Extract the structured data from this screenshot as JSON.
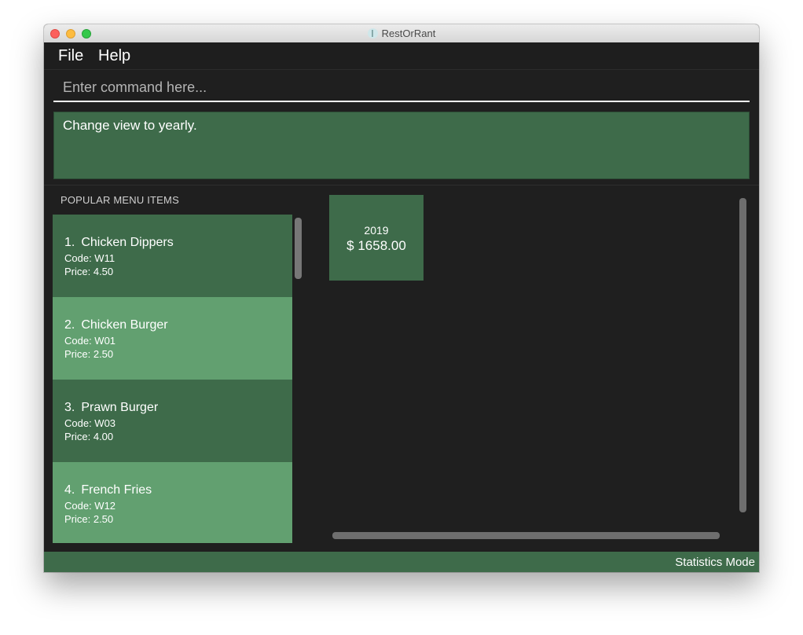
{
  "window": {
    "title": "RestOrRant"
  },
  "menu": {
    "file": "File",
    "help": "Help"
  },
  "command": {
    "placeholder": "Enter command here...",
    "value": ""
  },
  "result": {
    "message": "Change view to yearly."
  },
  "menu_list": {
    "header": "POPULAR MENU ITEMS",
    "items": [
      {
        "index": "1.",
        "name": "Chicken Dippers",
        "code": "Code: W11",
        "price": "Price: 4.50"
      },
      {
        "index": "2.",
        "name": "Chicken Burger",
        "code": "Code: W01",
        "price": "Price: 2.50"
      },
      {
        "index": "3.",
        "name": "Prawn Burger",
        "code": "Code: W03",
        "price": "Price: 4.00"
      },
      {
        "index": "4.",
        "name": "French Fries",
        "code": "Code: W12",
        "price": "Price: 2.50"
      }
    ]
  },
  "statistics": {
    "tiles": [
      {
        "year": "2019",
        "amount": "$ 1658.00"
      }
    ]
  },
  "status": {
    "mode": "Statistics Mode"
  },
  "colors": {
    "background": "#1f1f1f",
    "card_dark": "#3e6b4a",
    "card_light": "#62a070",
    "text": "#ffffff"
  }
}
